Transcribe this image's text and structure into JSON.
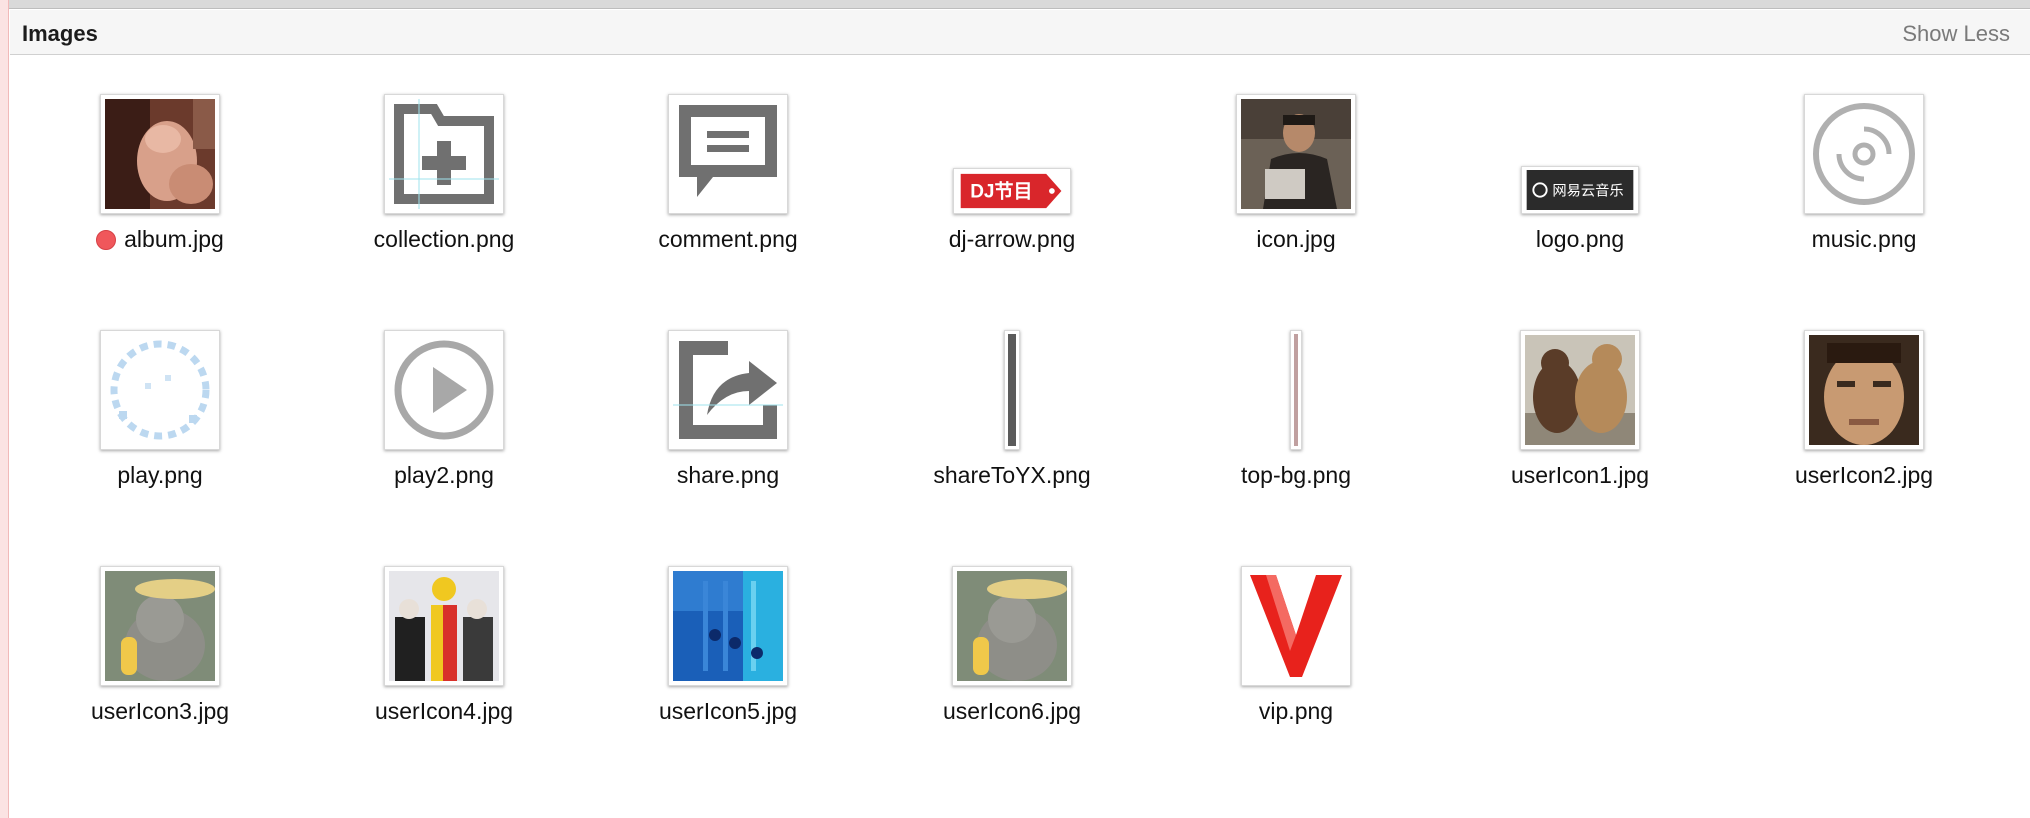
{
  "section": {
    "title": "Images",
    "toggle_label": "Show Less"
  },
  "files": [
    {
      "name": "album.jpg",
      "tag": "red",
      "icon": "album-photo-icon"
    },
    {
      "name": "collection.png",
      "icon": "collection-add-icon"
    },
    {
      "name": "comment.png",
      "icon": "comment-bubble-icon"
    },
    {
      "name": "dj-arrow.png",
      "icon": "dj-tag-icon",
      "badge_text": "DJ节目"
    },
    {
      "name": "icon.jpg",
      "icon": "portrait-photo-icon"
    },
    {
      "name": "logo.png",
      "icon": "netease-logo-icon",
      "badge_text": "网易云音乐"
    },
    {
      "name": "music.png",
      "icon": "music-disc-icon"
    },
    {
      "name": "play.png",
      "icon": "play-ring-icon"
    },
    {
      "name": "play2.png",
      "icon": "play-circle-icon"
    },
    {
      "name": "share.png",
      "icon": "share-arrow-icon"
    },
    {
      "name": "shareToYX.png",
      "icon": "thin-bar-icon"
    },
    {
      "name": "top-bg.png",
      "icon": "thin-line-icon"
    },
    {
      "name": "userIcon1.jpg",
      "icon": "bears-photo-icon"
    },
    {
      "name": "userIcon2.jpg",
      "icon": "face-photo-icon"
    },
    {
      "name": "userIcon3.jpg",
      "icon": "koala-photo-icon"
    },
    {
      "name": "userIcon4.jpg",
      "icon": "costume-photo-icon"
    },
    {
      "name": "userIcon5.jpg",
      "icon": "blue-abstract-photo-icon"
    },
    {
      "name": "userIcon6.jpg",
      "icon": "koala-photo-icon"
    },
    {
      "name": "vip.png",
      "icon": "vip-v-icon"
    }
  ],
  "colors": {
    "tag_red": "#f0575b",
    "dj_red": "#d9262b",
    "vip_red": "#e8221c",
    "logo_bg": "#2b2b2b"
  }
}
